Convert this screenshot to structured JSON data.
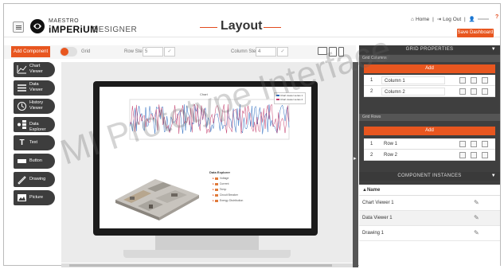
{
  "header": {
    "logo_small": "MAESTRO",
    "logo_big": "iMPERiUM",
    "logo_designer": "DESIGNER",
    "title": "Layout",
    "home": "Home",
    "logout": "Log Out",
    "separator": "|",
    "help": "?",
    "save_label": "Save Dashboard"
  },
  "toolbar": {
    "add_component": "Add Component",
    "grid_label": "Grid",
    "row_step_label": "Row Step",
    "row_step_value": "5",
    "column_step_label": "Column Step",
    "column_step_value": "4",
    "ok1": "✓",
    "ok2": "✓"
  },
  "components": [
    {
      "icon": "chart-icon",
      "label": "Chart Viewer"
    },
    {
      "icon": "data-viewer-icon",
      "label": "Data Viewer"
    },
    {
      "icon": "history-icon",
      "label": "History Viewer"
    },
    {
      "icon": "data-explorer-icon",
      "label": "Data Explorer"
    },
    {
      "icon": "text-icon",
      "label": "Text"
    },
    {
      "icon": "button-icon",
      "label": "Button"
    },
    {
      "icon": "drawing-icon",
      "label": "Drawing"
    },
    {
      "icon": "picture-icon",
      "label": "Picture"
    }
  ],
  "canvas": {
    "chart_title": "Chart",
    "legend": [
      "Chart viewer series 1",
      "Chart viewer series 2"
    ],
    "data_explorer_title": "Data Explorer",
    "tree_items": [
      "Voltage",
      "Current",
      "Temp",
      "Circuit Breaker",
      "Energy Distribution"
    ]
  },
  "right_panel": {
    "grid_properties": "GRID PROPERTIES",
    "grid_columns": "Grid Columns",
    "grid_rows": "Grid Rows",
    "add": "Add",
    "columns": [
      {
        "num": "1",
        "name": "Column 1"
      },
      {
        "num": "2",
        "name": "Column 2"
      }
    ],
    "rows": [
      {
        "num": "1",
        "name": "Row 1"
      },
      {
        "num": "2",
        "name": "Row 2"
      }
    ],
    "component_instances": "COMPONENT INSTANCES",
    "name_header": "▲Name",
    "instances": [
      "Chart Viewer 1",
      "Data Viewer 1",
      "Drawing 1"
    ]
  },
  "watermark": "MI Prototype Interface",
  "colors": {
    "accent": "#e8561f",
    "dark": "#3d3d3d"
  }
}
